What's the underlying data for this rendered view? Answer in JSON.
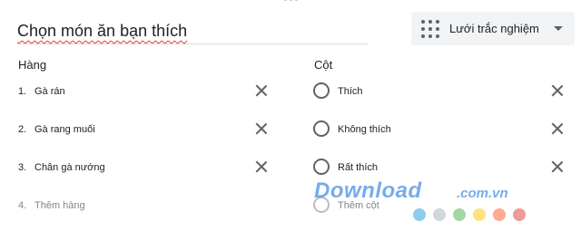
{
  "question": {
    "title": "Chọn món ăn bạn thích",
    "type_label": "Lưới trắc nghiệm",
    "type_icon": "grid-icon"
  },
  "rows": {
    "header": "Hàng",
    "items": [
      {
        "num": "1.",
        "label": "Gà rán"
      },
      {
        "num": "2.",
        "label": "Gà rang muối"
      },
      {
        "num": "3.",
        "label": "Chân gà nướng"
      }
    ],
    "add": {
      "num": "4.",
      "label": "Thêm hàng"
    }
  },
  "columns": {
    "header": "Cột",
    "items": [
      {
        "label": "Thích"
      },
      {
        "label": "Không thích"
      },
      {
        "label": "Rất thích"
      }
    ],
    "add": {
      "label": "Thêm cột"
    }
  },
  "watermark": {
    "text": "Download",
    "suffix": ".com.vn",
    "dot_colors": [
      "#8ecbef",
      "#cfd8dc",
      "#a5d6a7",
      "#ffe082",
      "#ffab91",
      "#ef9a9a"
    ]
  }
}
